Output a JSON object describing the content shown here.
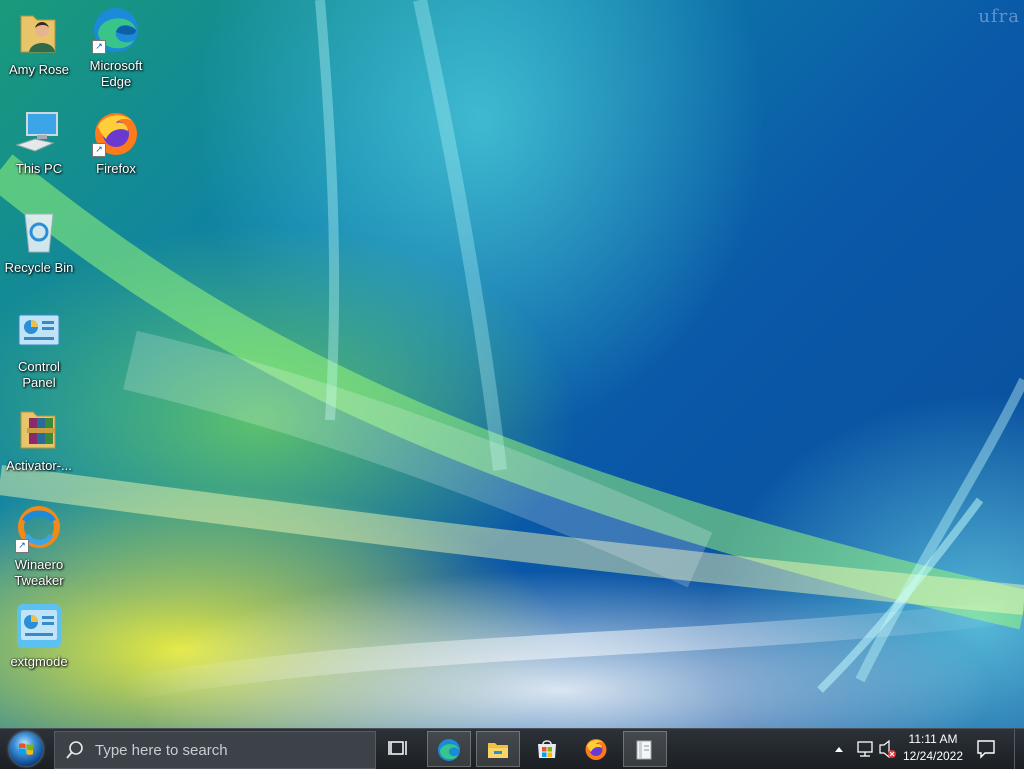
{
  "desktop": {
    "watermark": "ufra",
    "icons": [
      {
        "label": "Amy Rose",
        "icon": "user-folder-icon"
      },
      {
        "label": "Microsoft Edge",
        "icon": "edge-icon"
      },
      {
        "label": "This PC",
        "icon": "computer-icon"
      },
      {
        "label": "Firefox",
        "icon": "firefox-icon"
      },
      {
        "label": "Recycle Bin",
        "icon": "recycle-bin-icon"
      },
      {
        "label": "Control Panel",
        "icon": "control-panel-icon"
      },
      {
        "label": "Activator-...",
        "icon": "winrar-archive-icon"
      },
      {
        "label": "Winaero Tweaker",
        "icon": "winaero-tweaker-icon"
      },
      {
        "label": "extgmode",
        "icon": "extgmode-icon"
      }
    ]
  },
  "taskbar": {
    "search_placeholder": "Type here to search",
    "pinned": [
      "task-view-icon",
      "edge-icon",
      "file-explorer-icon",
      "store-icon",
      "firefox-icon",
      "notepad-icon"
    ],
    "tray": {
      "time": "11:11 AM",
      "date": "12/24/2022"
    }
  },
  "colors": {
    "taskbar": "#1f2429",
    "accent": "#0a58a8"
  }
}
